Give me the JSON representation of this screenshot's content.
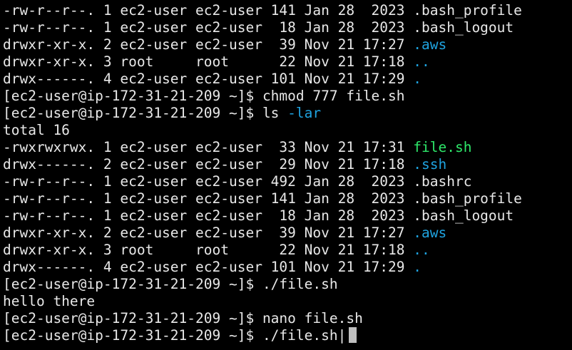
{
  "colors": {
    "background": "#000000",
    "default_text": "#e8e8e8",
    "directory": "#1fa3e0",
    "executable": "#2ee86a",
    "cursor": "#bfbfbf"
  },
  "lines": [
    {
      "type": "ls-row",
      "segments": [
        {
          "text": "-rw-r--r--. 1 ec2-user ec2-user 141 Jan 28  2023 ",
          "color": "default"
        },
        {
          "text": ".bash_profile",
          "color": "default"
        }
      ]
    },
    {
      "type": "ls-row",
      "segments": [
        {
          "text": "-rw-r--r--. 1 ec2-user ec2-user  18 Jan 28  2023 ",
          "color": "default"
        },
        {
          "text": ".bash_logout",
          "color": "default"
        }
      ]
    },
    {
      "type": "ls-row",
      "segments": [
        {
          "text": "drwxr-xr-x. 2 ec2-user ec2-user  39 Nov 21 17:27 ",
          "color": "default"
        },
        {
          "text": ".aws",
          "color": "directory"
        }
      ]
    },
    {
      "type": "ls-row",
      "segments": [
        {
          "text": "drwxr-xr-x. 3 root     root      22 Nov 21 17:18 ",
          "color": "default"
        },
        {
          "text": "..",
          "color": "directory"
        }
      ]
    },
    {
      "type": "ls-row",
      "segments": [
        {
          "text": "drwx------. 4 ec2-user ec2-user 101 Nov 21 17:29 ",
          "color": "default"
        },
        {
          "text": ".",
          "color": "directory"
        }
      ]
    },
    {
      "type": "prompt-line",
      "segments": [
        {
          "text": "[ec2-user@ip-172-31-21-209 ~]$ chmod 777 file.sh",
          "color": "default"
        }
      ]
    },
    {
      "type": "prompt-line",
      "segments": [
        {
          "text": "[ec2-user@ip-172-31-21-209 ~]$ ls ",
          "color": "default"
        },
        {
          "text": "-lar",
          "color": "directory"
        }
      ]
    },
    {
      "type": "output-line",
      "segments": [
        {
          "text": "total 16",
          "color": "default"
        }
      ]
    },
    {
      "type": "ls-row",
      "segments": [
        {
          "text": "-rwxrwxrwx. 1 ec2-user ec2-user  33 Nov 21 17:31 ",
          "color": "default"
        },
        {
          "text": "file.sh",
          "color": "executable"
        }
      ]
    },
    {
      "type": "ls-row",
      "segments": [
        {
          "text": "drwx------. 2 ec2-user ec2-user  29 Nov 21 17:18 ",
          "color": "default"
        },
        {
          "text": ".ssh",
          "color": "directory"
        }
      ]
    },
    {
      "type": "ls-row",
      "segments": [
        {
          "text": "-rw-r--r--. 1 ec2-user ec2-user 492 Jan 28  2023 ",
          "color": "default"
        },
        {
          "text": ".bashrc",
          "color": "default"
        }
      ]
    },
    {
      "type": "ls-row",
      "segments": [
        {
          "text": "-rw-r--r--. 1 ec2-user ec2-user 141 Jan 28  2023 ",
          "color": "default"
        },
        {
          "text": ".bash_profile",
          "color": "default"
        }
      ]
    },
    {
      "type": "ls-row",
      "segments": [
        {
          "text": "-rw-r--r--. 1 ec2-user ec2-user  18 Jan 28  2023 ",
          "color": "default"
        },
        {
          "text": ".bash_logout",
          "color": "default"
        }
      ]
    },
    {
      "type": "ls-row",
      "segments": [
        {
          "text": "drwxr-xr-x. 2 ec2-user ec2-user  39 Nov 21 17:27 ",
          "color": "default"
        },
        {
          "text": ".aws",
          "color": "directory"
        }
      ]
    },
    {
      "type": "ls-row",
      "segments": [
        {
          "text": "drwxr-xr-x. 3 root     root      22 Nov 21 17:18 ",
          "color": "default"
        },
        {
          "text": "..",
          "color": "directory"
        }
      ]
    },
    {
      "type": "ls-row",
      "segments": [
        {
          "text": "drwx------. 4 ec2-user ec2-user 101 Nov 21 17:29 ",
          "color": "default"
        },
        {
          "text": ".",
          "color": "directory"
        }
      ]
    },
    {
      "type": "prompt-line",
      "segments": [
        {
          "text": "[ec2-user@ip-172-31-21-209 ~]$ ./file.sh",
          "color": "default"
        }
      ]
    },
    {
      "type": "output-line",
      "segments": [
        {
          "text": "hello there",
          "color": "default"
        }
      ]
    },
    {
      "type": "prompt-line",
      "segments": [
        {
          "text": "[ec2-user@ip-172-31-21-209 ~]$ nano file.sh",
          "color": "default"
        }
      ]
    },
    {
      "type": "prompt-line",
      "segments": [
        {
          "text": "[ec2-user@ip-172-31-21-209 ~]$ ./file.sh|",
          "color": "default"
        }
      ],
      "cursor": true
    }
  ]
}
